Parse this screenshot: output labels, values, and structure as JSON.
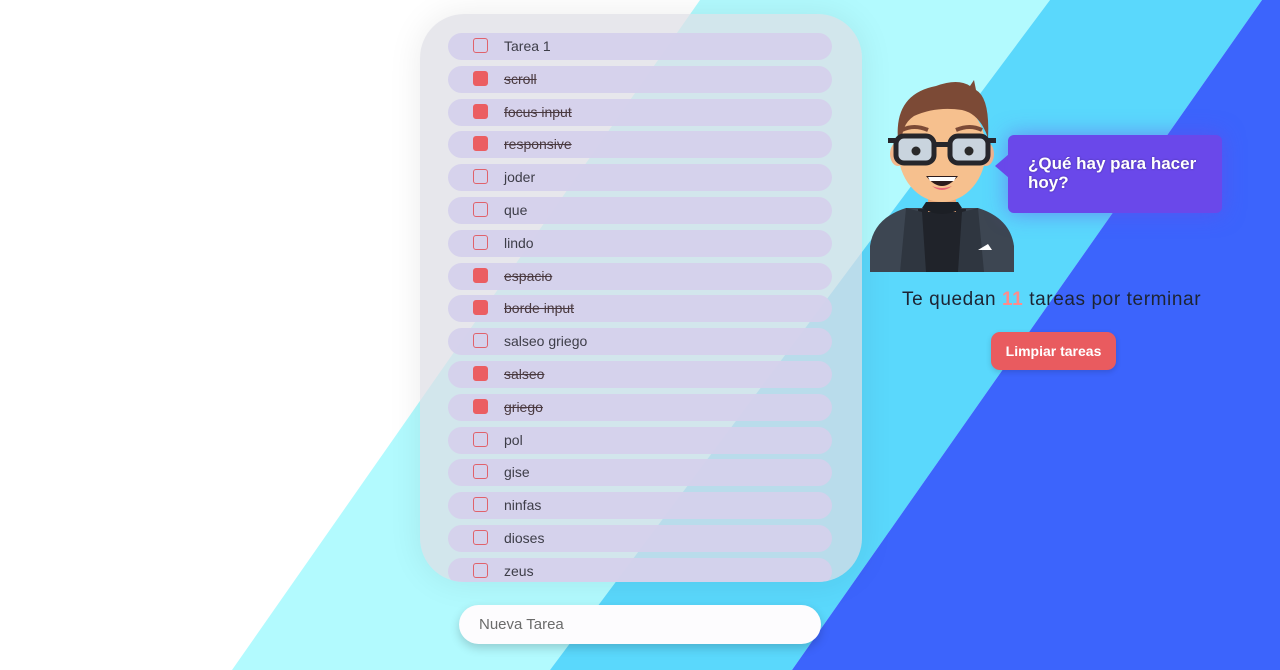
{
  "theme": {
    "accent": "#eb5e62",
    "bubble": "#6a48ea",
    "bg_cyan_light": "#b2fafe",
    "bg_cyan": "#5ad8fc",
    "bg_blue": "#3c64fc"
  },
  "tasks": [
    {
      "label": "Tarea 1",
      "done": false
    },
    {
      "label": "scroll",
      "done": true
    },
    {
      "label": "focus input",
      "done": true
    },
    {
      "label": "responsive",
      "done": true
    },
    {
      "label": "joder",
      "done": false
    },
    {
      "label": "que",
      "done": false
    },
    {
      "label": "lindo",
      "done": false
    },
    {
      "label": "espacio",
      "done": true
    },
    {
      "label": "borde input",
      "done": true
    },
    {
      "label": "salseo griego",
      "done": false
    },
    {
      "label": "salseo",
      "done": true
    },
    {
      "label": "griego",
      "done": true
    },
    {
      "label": "pol",
      "done": false
    },
    {
      "label": "gise",
      "done": false
    },
    {
      "label": "ninfas",
      "done": false
    },
    {
      "label": "dioses",
      "done": false
    },
    {
      "label": "zeus",
      "done": false
    }
  ],
  "new_task": {
    "placeholder": "Nueva Tarea",
    "value": ""
  },
  "bubble": {
    "text": "¿Qué hay para hacer hoy?"
  },
  "remaining": {
    "prefix": "Te quedan",
    "count": "11",
    "suffix": "tareas por terminar"
  },
  "clear_button": {
    "label": "Limpiar tareas"
  }
}
